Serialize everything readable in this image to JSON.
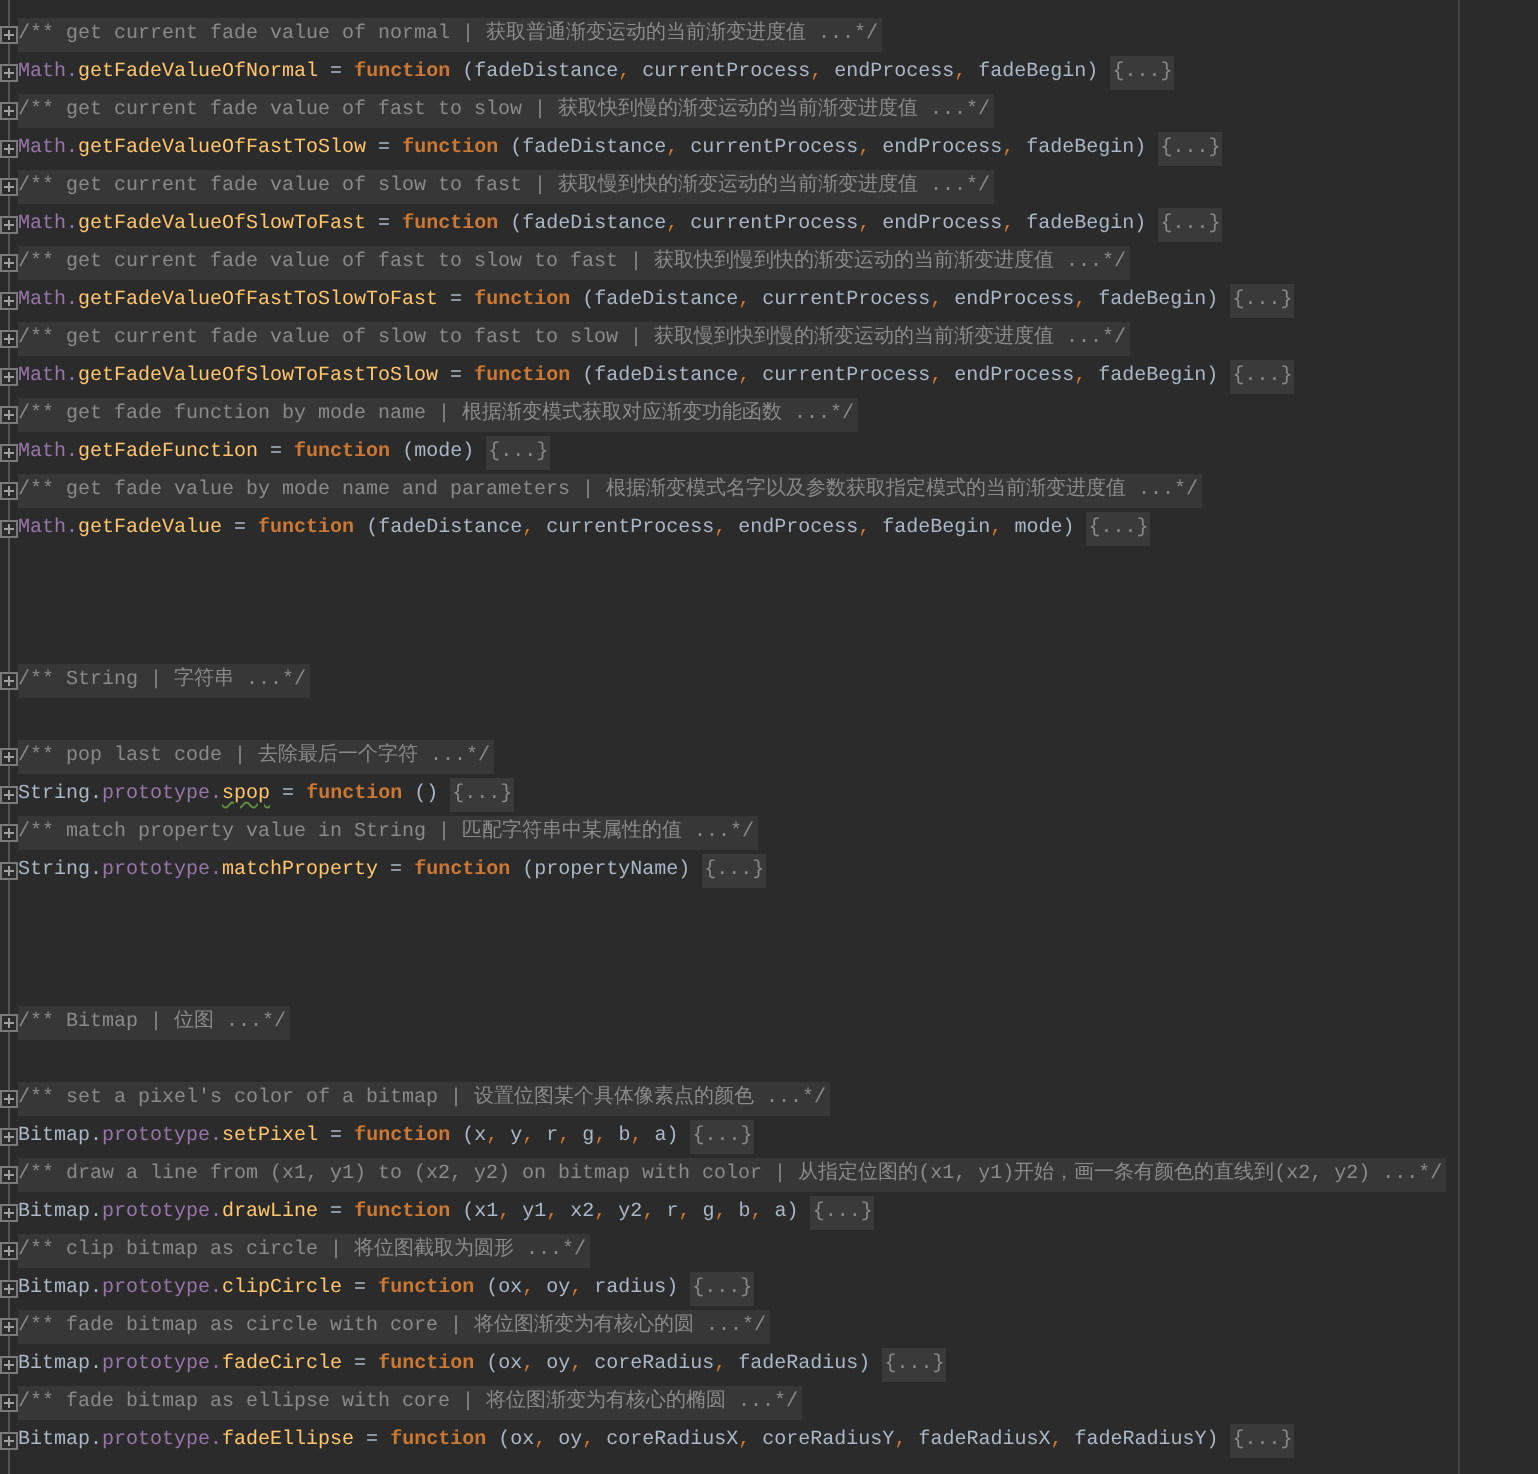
{
  "lines": [
    {
      "kind": "comment",
      "text": "/** get current fade value of normal | 获取普通渐变运动的当前渐变进度值 ...*/"
    },
    {
      "kind": "code",
      "object": "Math.",
      "name": "getFadeValueOfNormal",
      "typo_underline": false,
      "assign": " = ",
      "keyword": "function",
      "params": " (fadeDistance, currentProcess, endProcess, fadeBegin) ",
      "fold": "{...}"
    },
    {
      "kind": "comment",
      "text": "/** get current fade value of fast to slow | 获取快到慢的渐变运动的当前渐变进度值 ...*/"
    },
    {
      "kind": "code",
      "object": "Math.",
      "name": "getFadeValueOfFastToSlow",
      "typo_underline": false,
      "assign": " = ",
      "keyword": "function",
      "params": " (fadeDistance, currentProcess, endProcess, fadeBegin) ",
      "fold": "{...}"
    },
    {
      "kind": "comment",
      "text": "/** get current fade value of slow to fast | 获取慢到快的渐变运动的当前渐变进度值 ...*/"
    },
    {
      "kind": "code",
      "object": "Math.",
      "name": "getFadeValueOfSlowToFast",
      "typo_underline": false,
      "assign": " = ",
      "keyword": "function",
      "params": " (fadeDistance, currentProcess, endProcess, fadeBegin) ",
      "fold": "{...}"
    },
    {
      "kind": "comment",
      "text": "/** get current fade value of fast to slow to fast | 获取快到慢到快的渐变运动的当前渐变进度值 ...*/"
    },
    {
      "kind": "code",
      "object": "Math.",
      "name": "getFadeValueOfFastToSlowToFast",
      "typo_underline": false,
      "assign": " = ",
      "keyword": "function",
      "params": " (fadeDistance, currentProcess, endProcess, fadeBegin) ",
      "fold": "{...}"
    },
    {
      "kind": "comment",
      "text": "/** get current fade value of slow to fast to slow | 获取慢到快到慢的渐变运动的当前渐变进度值 ...*/"
    },
    {
      "kind": "code",
      "object": "Math.",
      "name": "getFadeValueOfSlowToFastToSlow",
      "typo_underline": false,
      "assign": " = ",
      "keyword": "function",
      "params": " (fadeDistance, currentProcess, endProcess, fadeBegin) ",
      "fold": "{...}"
    },
    {
      "kind": "comment",
      "text": "/** get fade function by mode name | 根据渐变模式获取对应渐变功能函数 ...*/"
    },
    {
      "kind": "code",
      "object": "Math.",
      "name": "getFadeFunction",
      "typo_underline": false,
      "assign": " = ",
      "keyword": "function",
      "params": " (mode) ",
      "fold": "{...}"
    },
    {
      "kind": "comment",
      "text": "/** get fade value by mode name and parameters | 根据渐变模式名字以及参数获取指定模式的当前渐变进度值 ...*/"
    },
    {
      "kind": "code",
      "object": "Math.",
      "name": "getFadeValue",
      "typo_underline": false,
      "assign": " = ",
      "keyword": "function",
      "params": " (fadeDistance, currentProcess, endProcess, fadeBegin, mode) ",
      "fold": "{...}"
    },
    {
      "kind": "blank"
    },
    {
      "kind": "blank"
    },
    {
      "kind": "blank"
    },
    {
      "kind": "comment",
      "text": "/** String | 字符串 ...*/"
    },
    {
      "kind": "blank"
    },
    {
      "kind": "comment",
      "text": "/** pop last code | 去除最后一个字符 ...*/"
    },
    {
      "kind": "code",
      "object": "String.",
      "member": "prototype.",
      "name": "spop",
      "typo_underline": true,
      "assign": " = ",
      "keyword": "function",
      "params": " () ",
      "fold": "{...}"
    },
    {
      "kind": "comment",
      "text": "/** match property value in String | 匹配字符串中某属性的值 ...*/"
    },
    {
      "kind": "code",
      "object": "String.",
      "member": "prototype.",
      "name": "matchProperty",
      "typo_underline": false,
      "assign": " = ",
      "keyword": "function",
      "params": " (propertyName) ",
      "fold": "{...}"
    },
    {
      "kind": "blank"
    },
    {
      "kind": "blank"
    },
    {
      "kind": "blank"
    },
    {
      "kind": "comment",
      "text": "/** Bitmap | 位图 ...*/"
    },
    {
      "kind": "blank"
    },
    {
      "kind": "comment",
      "text": "/** set a pixel's color of a bitmap | 设置位图某个具体像素点的颜色 ...*/"
    },
    {
      "kind": "code",
      "object": "Bitmap.",
      "member": "prototype.",
      "name": "setPixel",
      "typo_underline": false,
      "assign": " = ",
      "keyword": "function",
      "params": " (x, y, r, g, b, a) ",
      "fold": "{...}"
    },
    {
      "kind": "comment",
      "text": "/** draw a line from (x1, y1) to (x2, y2) on bitmap with color | 从指定位图的(x1, y1)开始，画一条有颜色的直线到(x2, y2) ...*/"
    },
    {
      "kind": "code",
      "object": "Bitmap.",
      "member": "prototype.",
      "name": "drawLine",
      "typo_underline": false,
      "assign": " = ",
      "keyword": "function",
      "params": " (x1, y1, x2, y2, r, g, b, a) ",
      "fold": "{...}"
    },
    {
      "kind": "comment",
      "text": "/** clip bitmap as circle | 将位图截取为圆形 ...*/"
    },
    {
      "kind": "code",
      "object": "Bitmap.",
      "member": "prototype.",
      "name": "clipCircle",
      "typo_underline": false,
      "assign": " = ",
      "keyword": "function",
      "params": " (ox, oy, radius) ",
      "fold": "{...}"
    },
    {
      "kind": "comment",
      "text": "/** fade bitmap as circle with core | 将位图渐变为有核心的圆 ...*/"
    },
    {
      "kind": "code",
      "object": "Bitmap.",
      "member": "prototype.",
      "name": "fadeCircle",
      "typo_underline": false,
      "assign": " = ",
      "keyword": "function",
      "params": " (ox, oy, coreRadius, fadeRadius) ",
      "fold": "{...}"
    },
    {
      "kind": "comment",
      "text": "/** fade bitmap as ellipse with core | 将位图渐变为有核心的椭圆 ...*/"
    },
    {
      "kind": "code",
      "object": "Bitmap.",
      "member": "prototype.",
      "name": "fadeEllipse",
      "typo_underline": false,
      "assign": " = ",
      "keyword": "function",
      "params": " (ox, oy, coreRadiusX, coreRadiusY, fadeRadiusX, fadeRadiusY) ",
      "fold": "{...}"
    }
  ]
}
